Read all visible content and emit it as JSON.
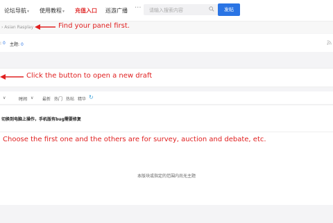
{
  "nav": {
    "items": [
      {
        "label": "论坛导航",
        "caret": "▾"
      },
      {
        "label": "使用教程",
        "caret": "▾"
      },
      {
        "label": "充值入口"
      },
      {
        "label": "巡游广播"
      }
    ],
    "more": "···",
    "search_placeholder": "请输入搜索内容",
    "post_button": "发帖"
  },
  "breadcrumb": "› Asian Rasplay",
  "stats": [
    {
      "label": ":",
      "value": "0"
    },
    {
      "label": "主题:",
      "value": "0"
    }
  ],
  "filters": [
    "∨",
    "时间",
    "∨",
    "最新",
    "热门",
    "热帖",
    "精华"
  ],
  "thread_title": "切换到电脑上操作，手机版有bug需要修复",
  "empty_text": "本版块或指定的范围内尚无主题",
  "annotations": {
    "a1": "Find your panel first.",
    "a2": "Click the button to open a new draft",
    "a3": "Choose the first one and the others are for survey, auction and debate, etc."
  },
  "colors": {
    "accent": "#2a74e4",
    "annotation": "#e02020",
    "active_nav": "#e03030"
  }
}
